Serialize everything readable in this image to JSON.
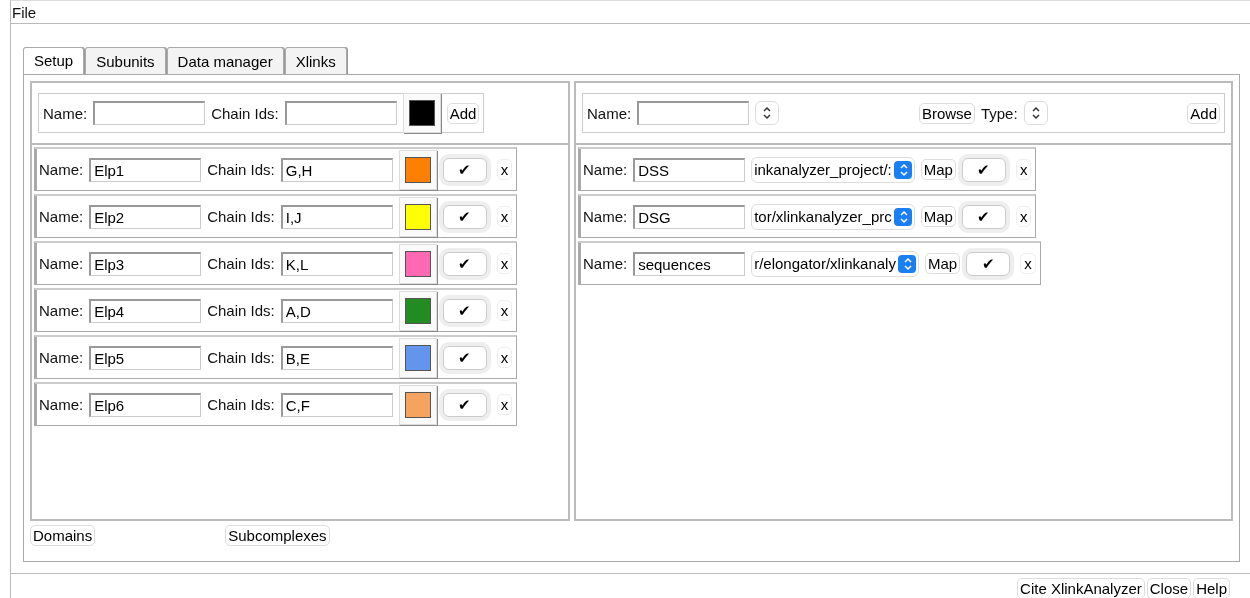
{
  "menu": [
    "File"
  ],
  "tabs": [
    {
      "label": "Setup",
      "selected": true
    },
    {
      "label": "Subunits",
      "selected": false
    },
    {
      "label": "Data manager",
      "selected": false
    },
    {
      "label": "Xlinks",
      "selected": false
    }
  ],
  "subunit_form": {
    "name_label": "Name:",
    "chain_label": "Chain Ids:",
    "color": "#000000",
    "add": "Add"
  },
  "subunits": [
    {
      "name_label": "Name:",
      "name": "Elp1",
      "chain_label": "Chain Ids:",
      "chains": "G,H",
      "color": "#ff8000",
      "check": "✔",
      "delete": "x"
    },
    {
      "name_label": "Name:",
      "name": "Elp2",
      "chain_label": "Chain Ids:",
      "chains": "I,J",
      "color": "#ffff00",
      "check": "✔",
      "delete": "x"
    },
    {
      "name_label": "Name:",
      "name": "Elp3",
      "chain_label": "Chain Ids:",
      "chains": "K,L",
      "color": "#ff69b4",
      "check": "✔",
      "delete": "x"
    },
    {
      "name_label": "Name:",
      "name": "Elp4",
      "chain_label": "Chain Ids:",
      "chains": "A,D",
      "color": "#228b22",
      "check": "✔",
      "delete": "x"
    },
    {
      "name_label": "Name:",
      "name": "Elp5",
      "chain_label": "Chain Ids:",
      "chains": "B,E",
      "color": "#6495ed",
      "check": "✔",
      "delete": "x"
    },
    {
      "name_label": "Name:",
      "name": "Elp6",
      "chain_label": "Chain Ids:",
      "chains": "C,F",
      "color": "#f4a460",
      "check": "✔",
      "delete": "x"
    }
  ],
  "data_form": {
    "name_label": "Name:",
    "browse": "Browse",
    "type_label": "Type:",
    "add": "Add"
  },
  "datasets": [
    {
      "name_label": "Name:",
      "name": "DSS",
      "path": "inkanalyzer_project/:",
      "map": "Map",
      "check": "✔",
      "delete": "x"
    },
    {
      "name_label": "Name:",
      "name": "DSG",
      "path": "tor/xlinkanalyzer_prc",
      "map": "Map",
      "check": "✔",
      "delete": "x"
    },
    {
      "name_label": "Name:",
      "name": "sequences",
      "path": "r/elongator/xlinkanaly",
      "map": "Map",
      "check": "✔",
      "delete": "x"
    }
  ],
  "bottom_buttons": [
    "Domains",
    "Subcomplexes"
  ],
  "footer_buttons": [
    "Cite XlinkAnalyzer",
    "Close",
    "Help"
  ]
}
